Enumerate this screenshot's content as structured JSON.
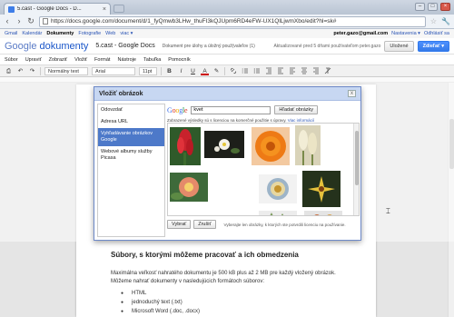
{
  "browser": {
    "tab_title": "5.cast - Google Docs - D...",
    "tab_close": "×",
    "back": "‹",
    "forward": "›",
    "reload": "↻",
    "url": "https://docs.google.com/document/d/1_fyQmwb3LHw_thuFI3kQJUpm6RD4eFW-UX1QlLjwmXbo/edit?hl=sk#",
    "star": "☆",
    "wrench": "🔧",
    "minimize": "–",
    "maximize": "□",
    "close": "×"
  },
  "gbar": {
    "items": [
      "Gmail",
      "Kalendár",
      "Dokumenty",
      "Fotografie",
      "Web",
      "viac ▾"
    ],
    "selected_index": 2,
    "user_email": "peter.gazo@gmail.com",
    "settings": "Nastavenia ▾",
    "signout": "Odhlásiť sa"
  },
  "doc": {
    "logo_prefix": "Google ",
    "logo_suffix": "dokumenty",
    "title": "5.cast - Google Docs",
    "save_state": "Dokument pre úlohy a úložný použ(valeľov (1)",
    "info": "Aktualizované pred 5 dňami používateľom peter.gazo",
    "share_label": "Uložené",
    "share_button": "Zdieľať ▾"
  },
  "menubar": [
    "Súbor",
    "Upraviť",
    "Zobraziť",
    "Vložiť",
    "Formát",
    "Nástroje",
    "Tabuľka",
    "Pomocník"
  ],
  "toolbar": {
    "undo": "↶",
    "redo": "↷",
    "print": "⎙",
    "style": "Normálny text",
    "font": "Arial",
    "size": "11pt",
    "bold": "B",
    "italic": "I",
    "underline": "U",
    "font_color": "A",
    "highlight": "✎"
  },
  "dialog": {
    "title": "Vložiť obrázok",
    "close": "x",
    "sidebar": [
      "Odovzdať",
      "Adresa URL",
      "Vyhľadávanie obrázkov Google",
      "Webové albumy služby Picasa"
    ],
    "active_index": 2,
    "google_logo": [
      "G",
      "o",
      "o",
      "g",
      "l",
      "e"
    ],
    "query": "kvet",
    "search_button": "Hľadať obrázky",
    "hint": "Zobrazené výsledky sú s licenciou na komerčné použitie s úpravy.",
    "hint_link": "Viac informácií",
    "select_button": "Vybrať",
    "cancel_button": "Zrušiť",
    "footer_hint": "Vyberajte len obrázky, k ktorých ste potvrdili licenciu na používanie."
  },
  "body": {
    "heading": "Súbory, s ktorými môžeme pracovať a ich obmedzenia",
    "paragraph": "Maximálna veľkosť nahratého dokumentu je 500 kB plus až 2 MB pre každý vložený obrázok. Môžeme nahrať dokumenty v nasledujúcich formátoch súborov:",
    "list": [
      "HTML",
      "jednoduchý text (.txt)",
      "Microsoft Word (.doc, .docx)"
    ]
  },
  "colors": {
    "accent": "#4d79c9",
    "dialog_title_bg": "#c7d7f2",
    "link": "#2a54b5"
  }
}
